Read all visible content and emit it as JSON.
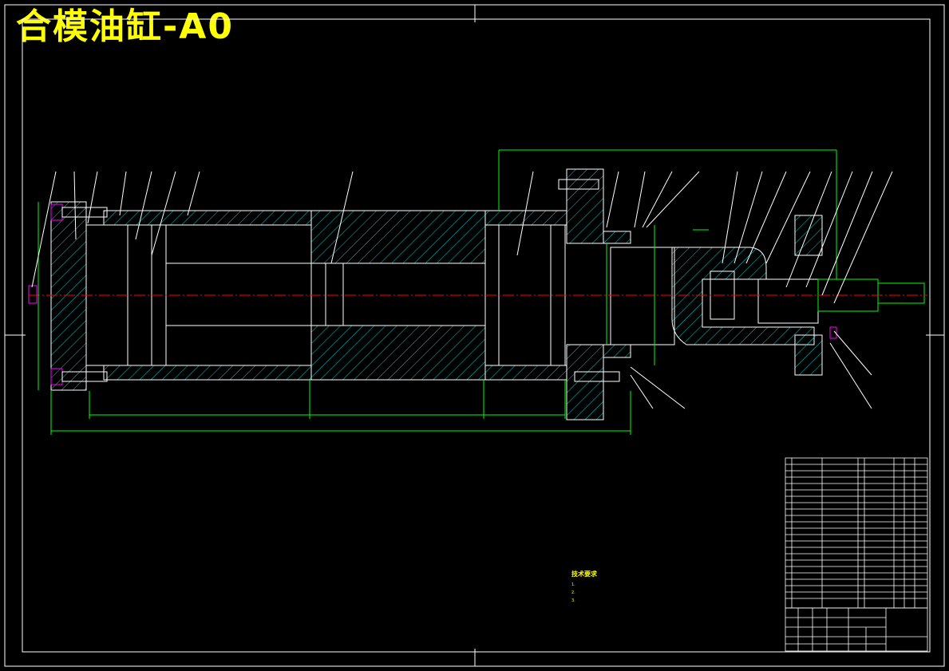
{
  "title": "合模油缸-A0",
  "colors": {
    "background": "#000000",
    "outline": "#ffffff",
    "hatch": "#00c8c8",
    "dimension": "#00ff00",
    "leader": "#ffffff",
    "centerline": "#ff0000",
    "bolt": "#ff00ff",
    "text": "#ffff00"
  },
  "technical_requirements": {
    "heading": "技术要求",
    "lines": [
      "1.",
      "2.",
      "3."
    ]
  }
}
